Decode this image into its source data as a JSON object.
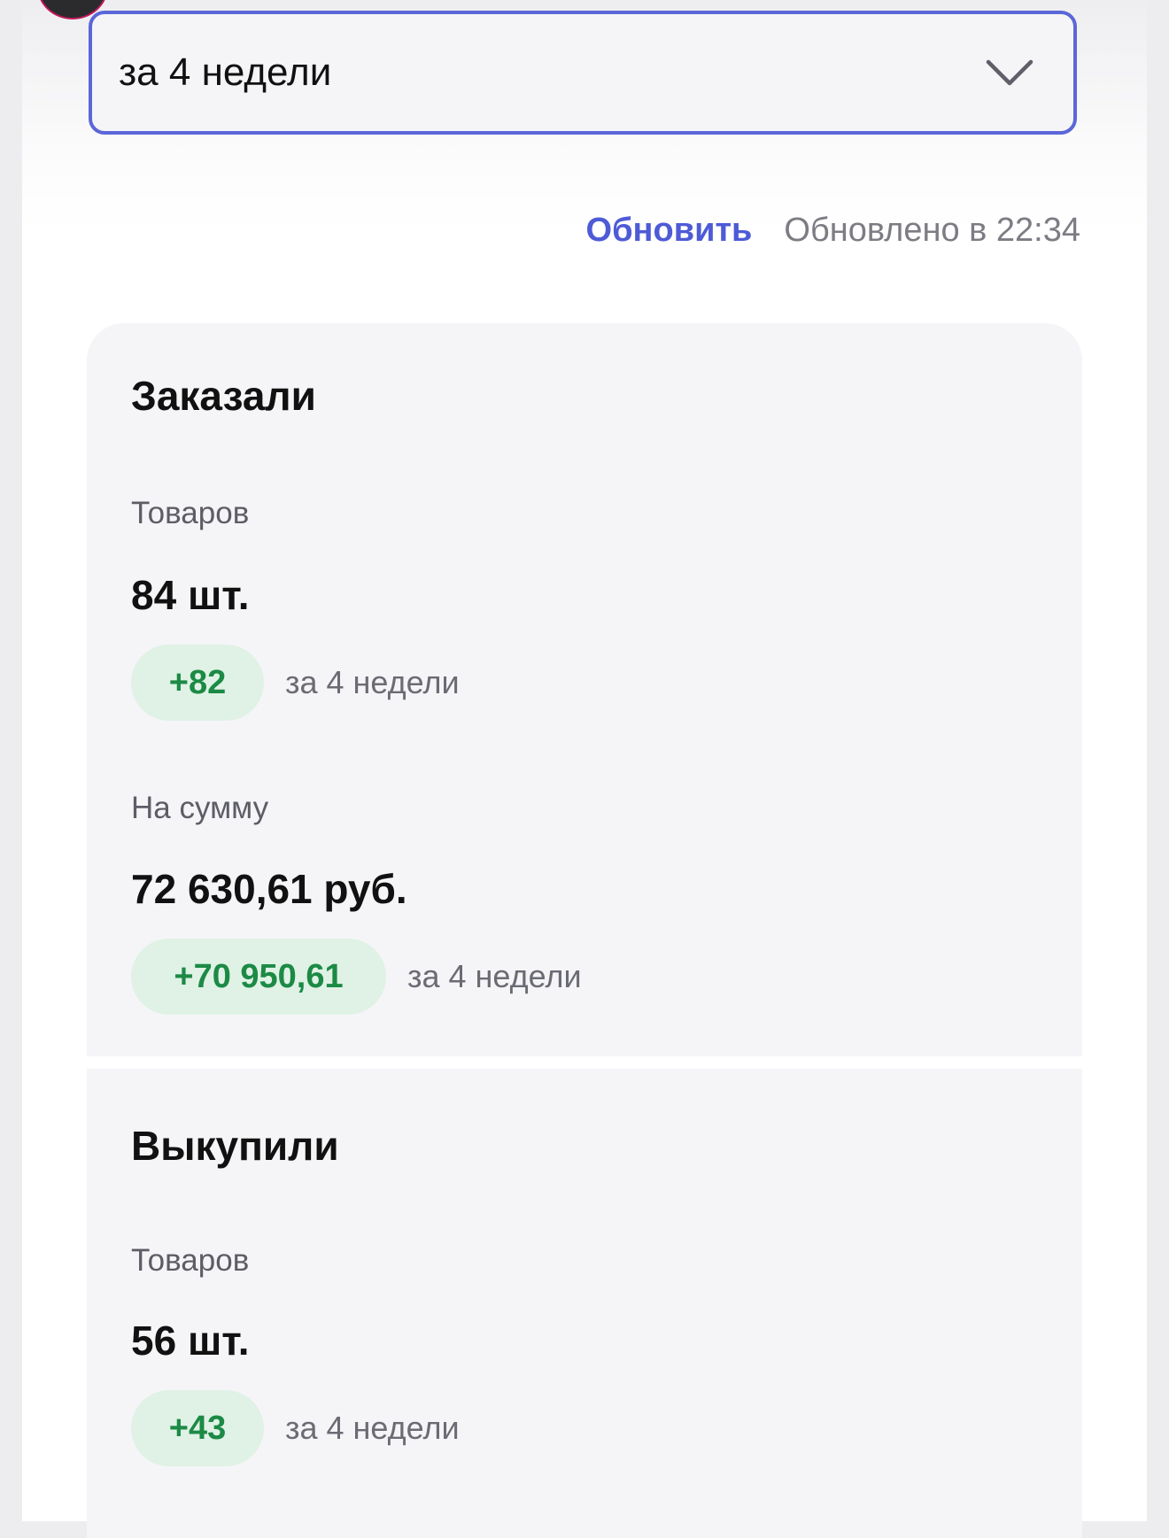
{
  "period_select": {
    "value": "за 4 недели",
    "icon": "chevron-down-icon"
  },
  "refresh": {
    "link_label": "Обновить",
    "updated_text": "Обновлено в 22:34"
  },
  "ordered": {
    "title": "Заказали",
    "items": {
      "label": "Товаров",
      "value": "84 шт.",
      "delta": "+82",
      "delta_period": "за 4 недели"
    },
    "sum": {
      "label": "На сумму",
      "value": "72 630,61 руб.",
      "delta": "+70 950,61",
      "delta_period": "за 4 недели"
    }
  },
  "bought": {
    "title": "Выкупили",
    "items": {
      "label": "Товаров",
      "value": "56 шт.",
      "delta": "+43",
      "delta_period": "за 4 недели"
    }
  },
  "colors": {
    "accent": "#4e5bd6",
    "select_border": "#5b67d8",
    "positive_text": "#1c8a45",
    "positive_bg": "#dff2e5",
    "card_bg": "#f5f5f8"
  }
}
